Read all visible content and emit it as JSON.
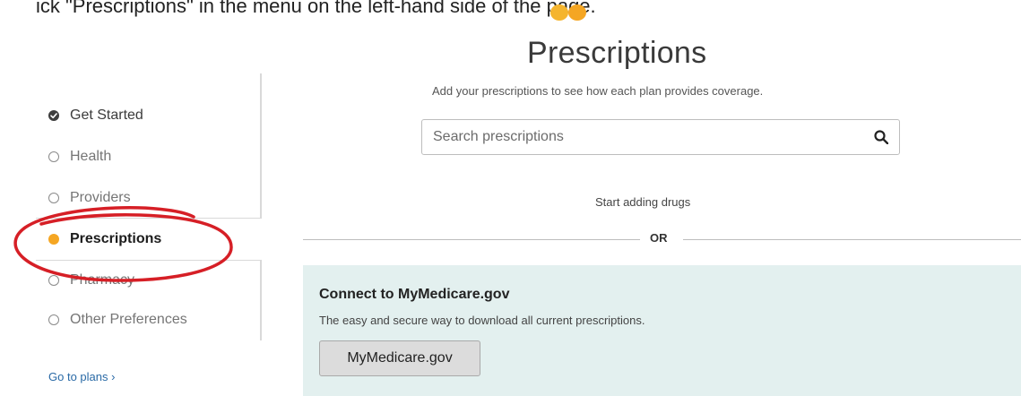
{
  "caption": "ick \"Prescriptions\" in the menu on the left-hand side of the page.",
  "page": {
    "title": "Prescriptions",
    "subtitle": "Add your prescriptions to see how each plan provides coverage."
  },
  "search": {
    "placeholder": "Search prescriptions",
    "icon": "search-icon"
  },
  "sidebar": {
    "items": [
      {
        "label": "Get Started",
        "state": "completed"
      },
      {
        "label": "Health",
        "state": "pending"
      },
      {
        "label": "Providers",
        "state": "pending"
      },
      {
        "label": "Prescriptions",
        "state": "active"
      },
      {
        "label": "Pharmacy",
        "state": "pending"
      },
      {
        "label": "Other Preferences",
        "state": "pending"
      }
    ],
    "go_to_plans": "Go to plans ›"
  },
  "main": {
    "start_text": "Start adding drugs",
    "or_label": "OR"
  },
  "connect": {
    "title": "Connect to MyMedicare.gov",
    "description": "The easy and secure way to download all current prescriptions.",
    "button_label": "MyMedicare.gov"
  },
  "colors": {
    "active_dot": "#f5a623",
    "annotation": "#d61f26",
    "panel_bg": "#e3f0ef",
    "link": "#2a6aa6"
  }
}
